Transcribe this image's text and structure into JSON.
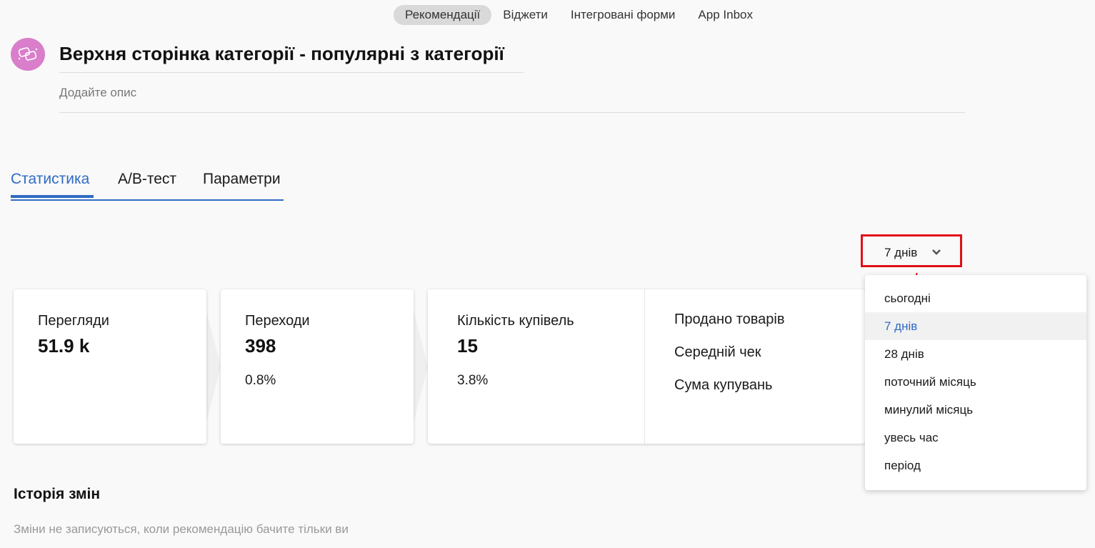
{
  "topnav": {
    "items": [
      {
        "label": "Рекомендації",
        "active": true
      },
      {
        "label": "Віджети"
      },
      {
        "label": "Інтегровані форми"
      },
      {
        "label": "App Inbox"
      }
    ]
  },
  "header": {
    "avatar_icon": "chat-bubbles-icon",
    "avatar_color": "#d97ecb",
    "title": "Верхня сторінка категорії - популярні з категорії",
    "description_placeholder": "Додайте опис"
  },
  "tabs": [
    {
      "label": "Статистика",
      "active": true
    },
    {
      "label": "А/В-тест"
    },
    {
      "label": "Параметри"
    }
  ],
  "period": {
    "selected": "7 днів",
    "options": [
      "сьогодні",
      "7 днів",
      "28 днів",
      "поточний місяць",
      "минулий місяць",
      "увесь час",
      "період"
    ]
  },
  "stats": {
    "views": {
      "label": "Перегляди",
      "value": "51.9 k"
    },
    "clicks": {
      "label": "Переходи",
      "value": "398",
      "percent": "0.8%"
    },
    "purchases": {
      "label": "Кількість купівель",
      "value": "15",
      "percent": "3.8%"
    },
    "right_labels": [
      "Продано товарів",
      "Середній чек",
      "Сума купувань"
    ]
  },
  "history": {
    "title": "Історія змін",
    "note": "Зміни не записуються, коли рекомендацію бачите тільки ви"
  },
  "colors": {
    "accent": "#2f6bc4",
    "highlight": "#e0101a"
  }
}
